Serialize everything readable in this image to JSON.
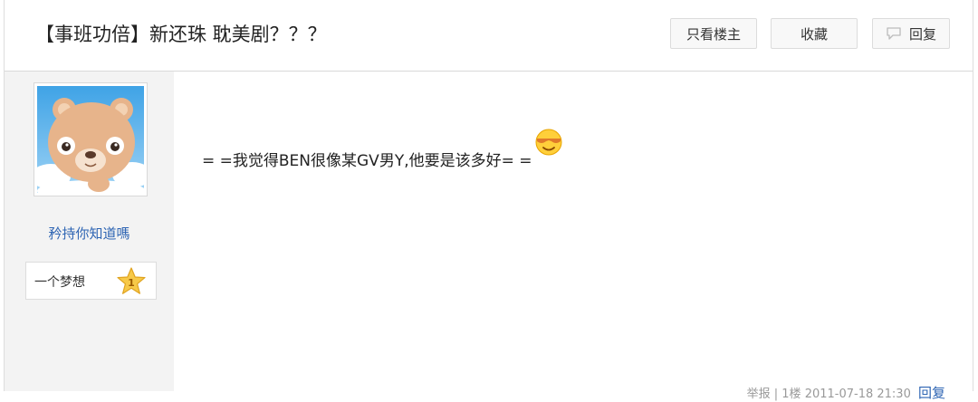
{
  "thread": {
    "title": "【事班功倍】新还珠 耽美剧？？？"
  },
  "toolbar": {
    "only_author_label": "只看楼主",
    "favorite_label": "收藏",
    "reply_label": "回复"
  },
  "post": {
    "author": {
      "username": "矜持你知道嗎",
      "title_label": "一个梦想",
      "level": "1"
    },
    "content": "= =我觉得BEN很像某GV男Y,他要是该多好= =",
    "meta_text": "举报 | 1楼 2011-07-18 21:30",
    "reply_link": "回复"
  },
  "colors": {
    "link": "#2d64b3",
    "sidebar_bg": "#f3f3f3",
    "border": "#dddddd"
  },
  "icons": {
    "reply": "speech-bubble-icon",
    "level": "star-badge-icon",
    "emoji": "cool-face-emoji-icon"
  }
}
